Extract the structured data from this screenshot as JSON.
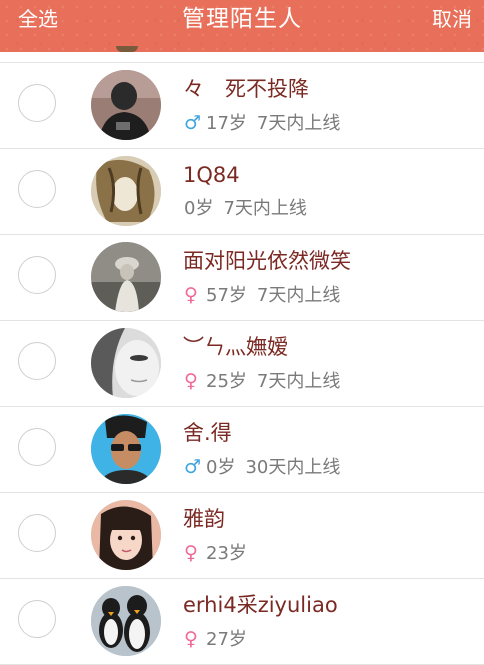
{
  "header": {
    "select_all": "全选",
    "title": "管理陌生人",
    "cancel": "取消",
    "color": "#e8705b"
  },
  "icons": {
    "male": "♂",
    "female": "♀"
  },
  "people": [
    {
      "name": "々　死不投降",
      "gender": "male",
      "age": "17岁",
      "online": "7天内上线"
    },
    {
      "name": "1Q84",
      "gender": "",
      "age": "0岁",
      "online": "7天内上线"
    },
    {
      "name": "面对阳光依然微笑",
      "gender": "female",
      "age": "57岁",
      "online": "7天内上线"
    },
    {
      "name": "︶ㄣ灬嫵嫒",
      "gender": "female",
      "age": "25岁",
      "online": "7天内上线"
    },
    {
      "name": "舍.得",
      "gender": "male",
      "age": "0岁",
      "online": "30天内上线"
    },
    {
      "name": "雅韵",
      "gender": "female",
      "age": "23岁",
      "online": ""
    },
    {
      "name": "erhi4采ziyuliao",
      "gender": "female",
      "age": "27岁",
      "online": ""
    }
  ]
}
